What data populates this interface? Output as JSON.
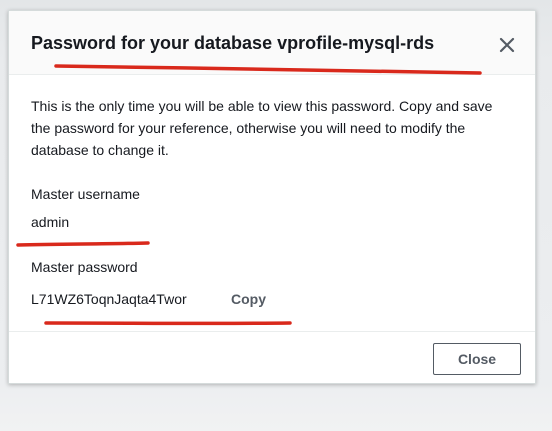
{
  "dialog": {
    "title": "Password for your database vprofile-mysql-rds",
    "close_icon": "close-icon",
    "intro_text": "This is the only time you will be able to view this password. Copy and save the password for your reference, otherwise you will need to modify the database to change it.",
    "username_label": "Master username",
    "username_value": "admin",
    "password_label": "Master password",
    "password_value": "L71WZ6ToqnJaqta4Twor",
    "copy_label": "Copy",
    "close_button_label": "Close"
  },
  "colors": {
    "title_text": "#16191f",
    "secondary_text": "#545b64",
    "annotation_red": "#d9291c",
    "header_bg": "#fafafa"
  }
}
